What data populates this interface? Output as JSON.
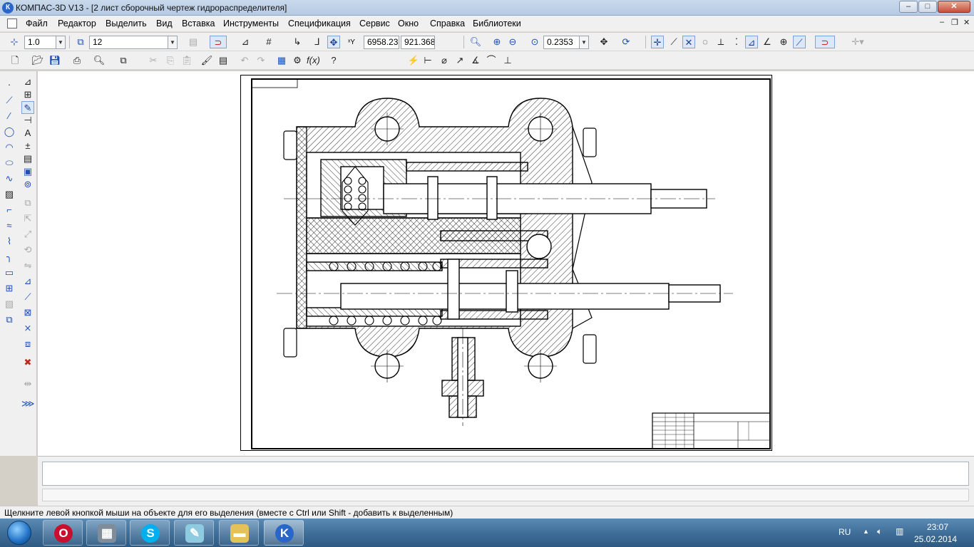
{
  "titlebar": {
    "app_icon": "К",
    "title": "КОМПАС-3D V13 - [2 лист сборочный чертеж гидрораспределителя]",
    "minimize": "–",
    "maximize": "□",
    "close": "✕"
  },
  "menu": {
    "items": [
      "Файл",
      "Редактор",
      "Выделить",
      "Вид",
      "Вставка",
      "Инструменты",
      "Спецификация",
      "Сервис",
      "Окно",
      "Справка",
      "Библиотеки"
    ],
    "mdi_minimize": "–",
    "mdi_restore": "❐",
    "mdi_close": "✕"
  },
  "toolbar1": {
    "step_value": "1.0",
    "layer_value": "12",
    "coord_x": "6958.23",
    "coord_y": "921.368",
    "zoom_value": "0.2353",
    "dropdown_arrow": "▼"
  },
  "status": {
    "hint": "Щелкните левой кнопкой мыши на объекте для его выделения (вместе с Ctrl или Shift - добавить к выделенным)"
  },
  "taskbar": {
    "language": "RU",
    "time": "23:07",
    "date": "25.02.2014",
    "apps": [
      "opera-icon",
      "calculator-icon",
      "skype-icon",
      "notepad-icon",
      "explorer-icon",
      "kompas-icon"
    ]
  },
  "colors": {
    "accent": "#1d4fb5",
    "taskbar": "#406f99",
    "title_bar": "#c9d9ec"
  }
}
